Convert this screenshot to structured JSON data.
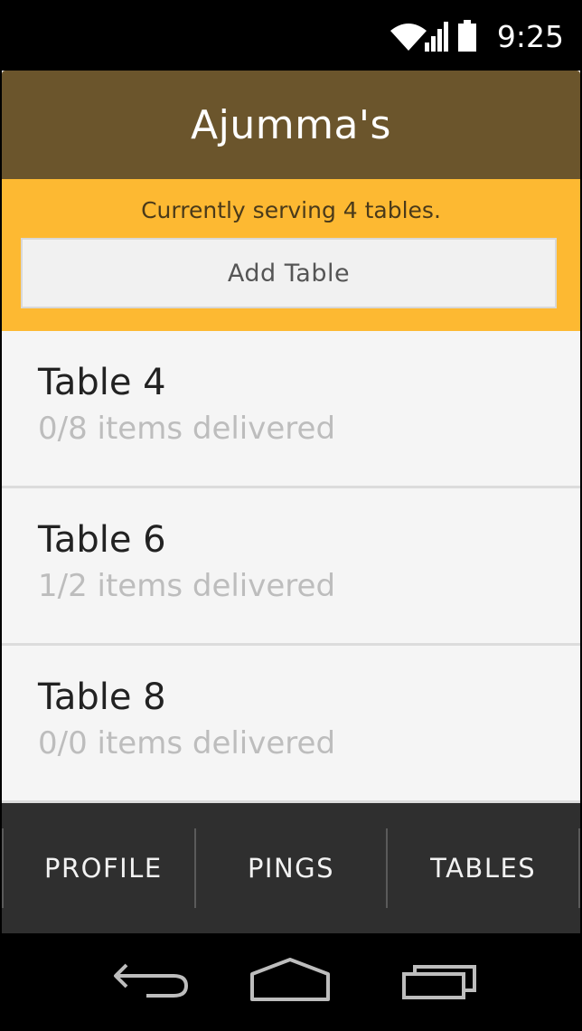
{
  "status_bar": {
    "time": "9:25",
    "icons": [
      "wifi-icon",
      "signal-icon",
      "battery-icon"
    ]
  },
  "header": {
    "title": "Ajumma's"
  },
  "serving": {
    "text": "Currently serving 4 tables.",
    "add_button_label": "Add Table"
  },
  "tables": [
    {
      "name": "Table 4",
      "status": "0/8 items delivered"
    },
    {
      "name": "Table 6",
      "status": "1/2 items delivered"
    },
    {
      "name": "Table 8",
      "status": "0/0 items delivered"
    }
  ],
  "tabs": [
    {
      "label": "PROFILE"
    },
    {
      "label": "PINGS"
    },
    {
      "label": "TABLES"
    }
  ],
  "nav_bar": {
    "buttons": [
      "back-icon",
      "home-icon",
      "recents-icon"
    ]
  },
  "colors": {
    "header_bg": "#6b552c",
    "serving_bg": "#fdb932",
    "tab_bar_bg": "#2f2f2f",
    "list_bg": "#f5f5f5"
  }
}
